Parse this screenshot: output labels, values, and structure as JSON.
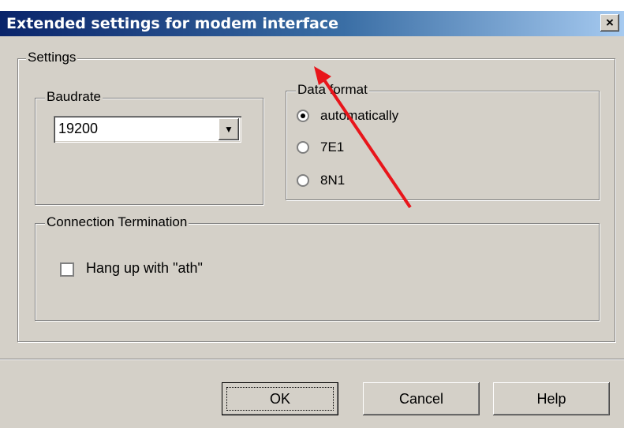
{
  "window": {
    "title": "Extended settings for modem interface",
    "close_label": "×"
  },
  "settings_group": {
    "label": "Settings"
  },
  "baudrate": {
    "label": "Baudrate",
    "value": "19200",
    "arrow": "▼"
  },
  "data_format": {
    "label": "Data format",
    "options": [
      {
        "label": "automatically",
        "checked": true
      },
      {
        "label": "7E1",
        "checked": false
      },
      {
        "label": "8N1",
        "checked": false
      }
    ]
  },
  "connection_termination": {
    "label": "Connection Termination",
    "hangup": {
      "label": "Hang up with \"ath\"",
      "checked": false
    }
  },
  "buttons": {
    "ok": "OK",
    "cancel": "Cancel",
    "help": "Help"
  },
  "annotation": {
    "color": "#e8151b"
  }
}
